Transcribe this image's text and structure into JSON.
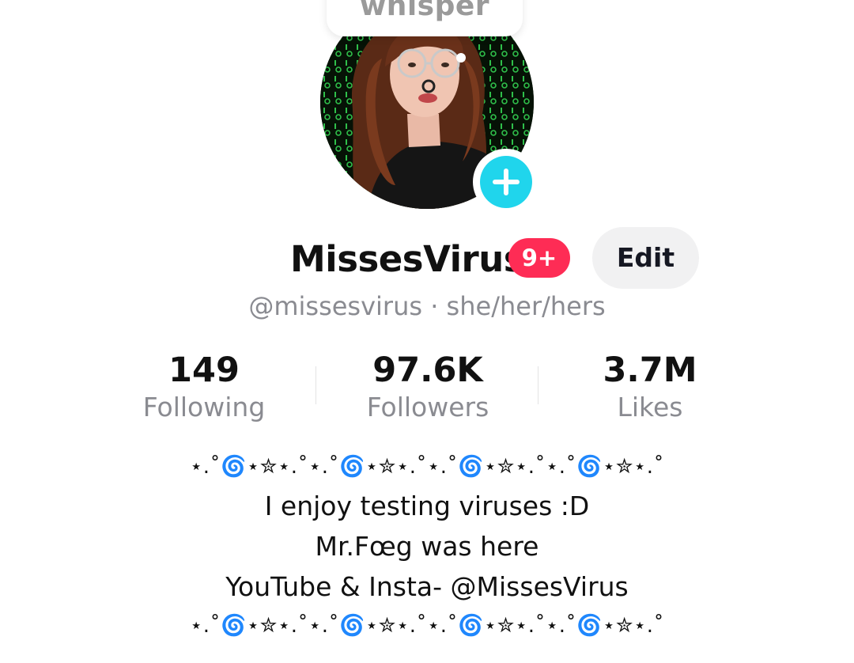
{
  "bubble": {
    "text": "whisper"
  },
  "profile": {
    "display_name": "MissesVirus",
    "notification_badge": "9+",
    "edit_label": "Edit",
    "handle_line": "@missesvirus · she/her/hers"
  },
  "stats": {
    "following": {
      "value": "149",
      "label": "Following"
    },
    "followers": {
      "value": "97.6K",
      "label": "Followers"
    },
    "likes": {
      "value": "3.7M",
      "label": "Likes"
    }
  },
  "bio": {
    "decoration_top": "⋆.˚🌀⋆✮⋆.˚⋆.˚🌀⋆✮⋆.˚⋆.˚🌀⋆✮⋆.˚⋆.˚🌀⋆✮⋆.˚",
    "lines": [
      "I enjoy testing viruses :D",
      "Mr.Fœg was here",
      "YouTube & Insta- @MissesVirus"
    ],
    "decoration_bottom": "⋆.˚🌀⋆✮⋆.˚⋆.˚🌀⋆✮⋆.˚⋆.˚🌀⋆✮⋆.˚⋆.˚🌀⋆✮⋆.˚"
  },
  "colors": {
    "accent_badge": "#fe2c55",
    "add_button": "#20d5ec",
    "muted_text": "#8a8b91",
    "edit_button_bg": "#f1f1f2"
  },
  "icons": {
    "add": "plus-icon",
    "avatar": "profile-photo"
  }
}
